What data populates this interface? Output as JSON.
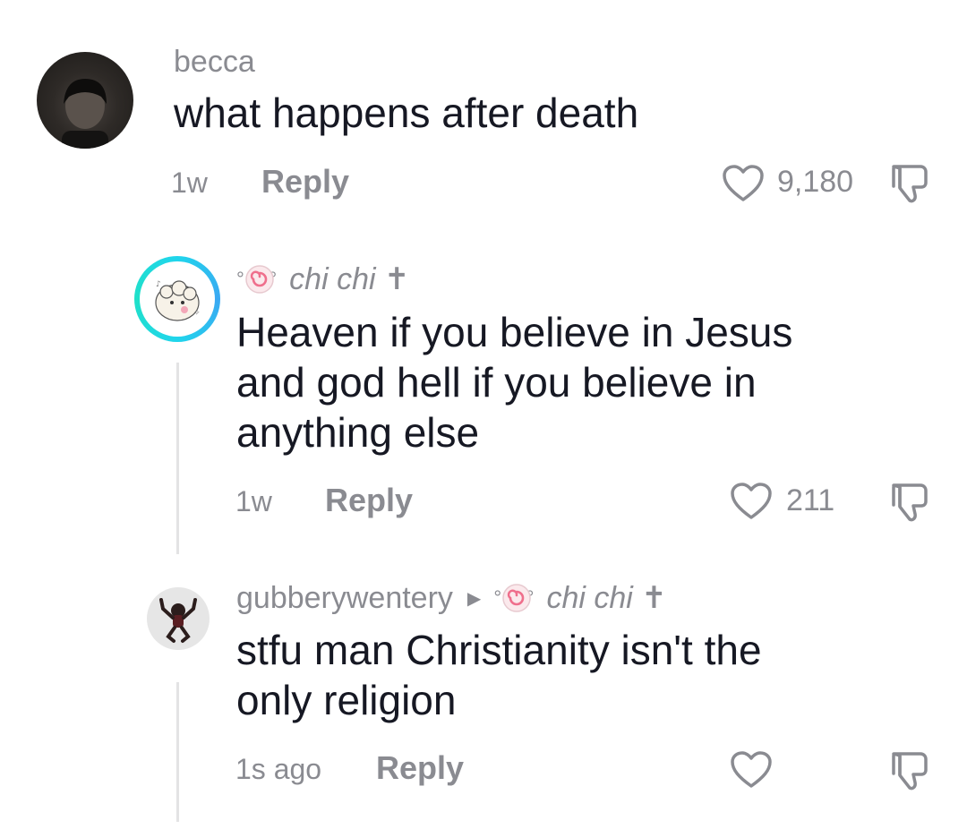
{
  "comments": [
    {
      "username": "becca",
      "text": "what happens after death",
      "time": "1w",
      "reply_label": "Reply",
      "likes": "9,180",
      "avatar_icon": "dark-photo-avatar"
    },
    {
      "username": "chi chi ✝",
      "username_deco": "°.˚ ° ",
      "text_lines": [
        "Heaven if you believe in Jesus",
        "and god hell if you believe in",
        "anything else"
      ],
      "time": "1w",
      "reply_label": "Reply",
      "likes": "211",
      "avatar_icon": "cartoon-sheep-avatar"
    },
    {
      "username": "gubberywentery",
      "reply_to": "chi chi ✝",
      "reply_to_deco": "°.˚ ° ",
      "text_lines": [
        "stfu man Christianity isn't the",
        "only religion"
      ],
      "time": "1s ago",
      "reply_label": "Reply",
      "likes": "",
      "avatar_icon": "dancing-figure-avatar"
    }
  ],
  "colors": {
    "text": "#161823",
    "muted": "#8a8b91",
    "story_ring": "#20d5ec",
    "thread_line": "#e3e3e4"
  }
}
